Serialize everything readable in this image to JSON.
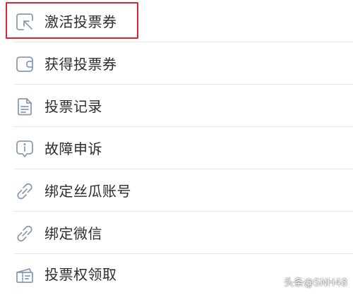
{
  "menu": {
    "items": [
      {
        "label": "激活投票券",
        "icon": "activate-icon"
      },
      {
        "label": "获得投票券",
        "icon": "wallet-icon"
      },
      {
        "label": "投票记录",
        "icon": "document-icon"
      },
      {
        "label": "故障申诉",
        "icon": "info-icon"
      },
      {
        "label": "绑定丝瓜账号",
        "icon": "link-icon"
      },
      {
        "label": "绑定微信",
        "icon": "link-icon"
      },
      {
        "label": "投票权领取",
        "icon": "ticket-icon"
      }
    ]
  },
  "watermark": {
    "text": "头条@SNH48"
  },
  "colors": {
    "icon": "#8a9bb5",
    "text": "#2d2d2d",
    "divider": "#e6e6e6",
    "highlight": "#d8262f"
  }
}
